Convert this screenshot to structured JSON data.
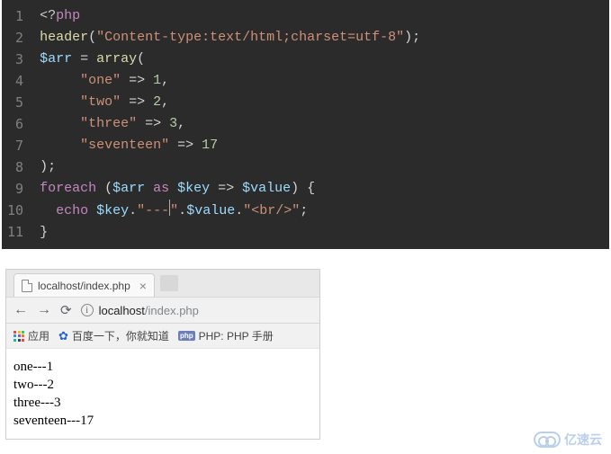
{
  "code": {
    "lines": [
      "1",
      "2",
      "3",
      "4",
      "5",
      "6",
      "7",
      "8",
      "9",
      "10",
      "11"
    ],
    "l1_open": "<?",
    "l1_php": "php",
    "l2_fn": "header",
    "l2_p1": "(",
    "l2_str": "\"Content-type:text/html;charset=utf-8\"",
    "l2_p2": ");",
    "l3_var": "$arr",
    "l3_eq": " = ",
    "l3_fn": "array",
    "l3_p": "(",
    "l4_str": "\"one\"",
    "l4_ar": " => ",
    "l4_num": "1",
    "l4_c": ",",
    "l5_str": "\"two\"",
    "l5_ar": " => ",
    "l5_num": "2",
    "l5_c": ",",
    "l6_str": "\"three\"",
    "l6_ar": " => ",
    "l6_num": "3",
    "l6_c": ",",
    "l7_str": "\"seventeen\"",
    "l7_ar": " => ",
    "l7_num": "17",
    "l8": ");",
    "l9_kw": "foreach",
    "l9_p1": " (",
    "l9_v1": "$arr",
    "l9_as": " as ",
    "l9_v2": "$key",
    "l9_ar": " => ",
    "l9_v3": "$value",
    "l9_p2": ") {",
    "l10_fn": "echo",
    "l10_sp": " ",
    "l10_v1": "$key",
    "l10_d1": ".",
    "l10_s1": "\"---",
    "l10_s1b": "\"",
    "l10_d2": ".",
    "l10_v2": "$value",
    "l10_d3": ".",
    "l10_s2": "\"<br/>\"",
    "l10_end": ";",
    "l11": "}"
  },
  "browser": {
    "tab_title": "localhost/index.php",
    "url_host": "localhost",
    "url_path": "/index.php",
    "bm_apps": "应用",
    "bm_baidu": "百度一下，你就知道",
    "bm_php_badge": "php",
    "bm_php": "PHP: PHP 手册"
  },
  "output": {
    "r1": "one---1",
    "r2": "two---2",
    "r3": "three---3",
    "r4": "seventeen---17"
  },
  "watermark": "亿速云"
}
